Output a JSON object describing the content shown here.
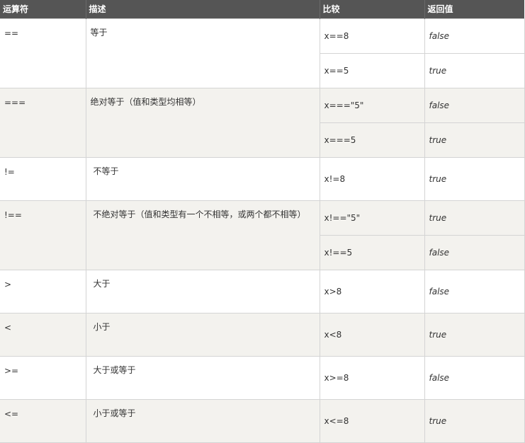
{
  "headers": {
    "operator": "运算符",
    "description": "描述",
    "comparison": "比较",
    "return_value": "返回值"
  },
  "rows": [
    {
      "op": "==",
      "desc": "等于",
      "shade": false,
      "cases": [
        {
          "cmp": "x==8",
          "ret": "false"
        },
        {
          "cmp": "x==5",
          "ret": "true"
        }
      ]
    },
    {
      "op": "===",
      "desc": "绝对等于（值和类型均相等）",
      "shade": true,
      "cases": [
        {
          "cmp": "x===\"5\"",
          "ret": "false"
        },
        {
          "cmp": "x===5",
          "ret": "true"
        }
      ]
    },
    {
      "op": "!=",
      "desc": "不等于",
      "shade": false,
      "cases": [
        {
          "cmp": "x!=8",
          "ret": "true"
        }
      ]
    },
    {
      "op": "!==",
      "desc": "不绝对等于（值和类型有一个不相等，或两个都不相等）",
      "shade": true,
      "cases": [
        {
          "cmp": "x!==\"5\"",
          "ret": "true"
        },
        {
          "cmp": "x!==5",
          "ret": "false"
        }
      ]
    },
    {
      "op": ">",
      "desc": "大于",
      "shade": false,
      "cases": [
        {
          "cmp": "x>8",
          "ret": "false"
        }
      ]
    },
    {
      "op": "<",
      "desc": "小于",
      "shade": true,
      "cases": [
        {
          "cmp": "x<8",
          "ret": "true"
        }
      ]
    },
    {
      "op": ">=",
      "desc": "大于或等于",
      "shade": false,
      "cases": [
        {
          "cmp": "x>=8",
          "ret": "false"
        }
      ]
    },
    {
      "op": "<=",
      "desc": "小于或等于",
      "shade": true,
      "cases": [
        {
          "cmp": "x<=8",
          "ret": "true"
        }
      ]
    }
  ]
}
